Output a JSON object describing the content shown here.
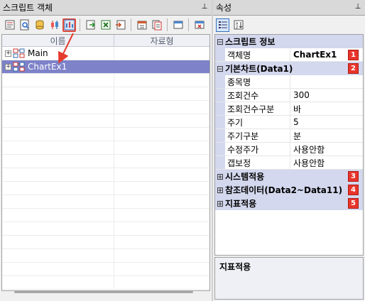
{
  "left_panel": {
    "title": "스크립트 객체",
    "columns": [
      "이름",
      "자료형"
    ],
    "tree": [
      {
        "label": "Main",
        "selected": false
      },
      {
        "label": "ChartEx1",
        "selected": true
      }
    ]
  },
  "right_panel": {
    "title": "속성",
    "categories": [
      {
        "label": "스크립트 정보",
        "badge": "1",
        "expanded": true,
        "props": [
          {
            "name": "객체명",
            "value": "ChartEx1"
          }
        ]
      },
      {
        "label": "기본차트(Data1)",
        "badge": "2",
        "expanded": true,
        "props": [
          {
            "name": "종목명",
            "value": ""
          },
          {
            "name": "조회건수",
            "value": "300"
          },
          {
            "name": "조회건수구분",
            "value": "바"
          },
          {
            "name": "주기",
            "value": "5"
          },
          {
            "name": "주기구분",
            "value": "분"
          },
          {
            "name": "수정주가",
            "value": "사용안함"
          },
          {
            "name": "갭보정",
            "value": "사용안함"
          }
        ]
      },
      {
        "label": "시스템적용",
        "badge": "3",
        "expanded": false,
        "props": []
      },
      {
        "label": "참조데이터(Data2~Data11)",
        "badge": "4",
        "expanded": false,
        "props": []
      },
      {
        "label": "지표적용",
        "badge": "5",
        "expanded": false,
        "props": []
      }
    ],
    "description_title": "지표적용"
  },
  "colors": {
    "selection": "#7d82c9",
    "category_bg": "#d4d8ee",
    "badge": "#e8352b",
    "annotation_arrow": "#e53a2e"
  }
}
